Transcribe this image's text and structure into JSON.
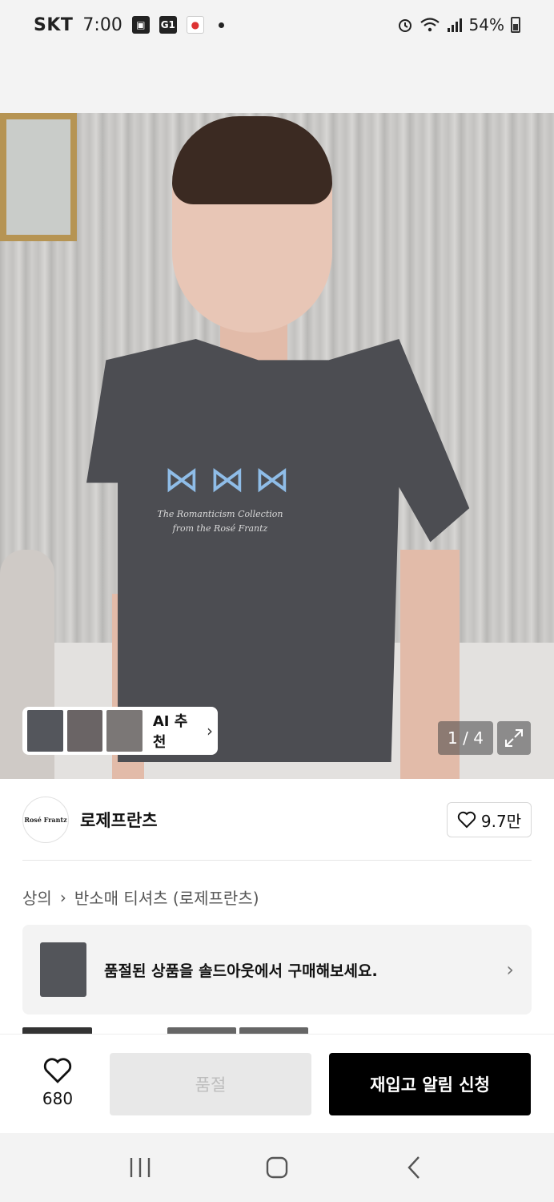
{
  "status_bar": {
    "carrier": "SKT",
    "time": "7:00",
    "notif_g1": "G1",
    "battery": "54%",
    "icons": [
      "gallery-icon",
      "g1-icon",
      "deal-icon",
      "alarm-icon",
      "wifi-icon",
      "signal-icon",
      "battery-icon"
    ]
  },
  "product_image": {
    "print_text": "The Romanticism Collection from the Rosé Frantz",
    "ai_recommend_label": "AI 추천",
    "counter": "1 / 4"
  },
  "brand": {
    "logo_text": "Rosé Frantz",
    "name": "로제프란츠",
    "likes": "9.7만"
  },
  "breadcrumb": {
    "category": "상의",
    "subcategory": "반소매 티셔츠 (로제프란츠)"
  },
  "soldout_banner": {
    "text": "품절된 상품을 솔드아웃에서 구매해보세요."
  },
  "bottom_bar": {
    "wish_count": "680",
    "soldout_label": "품절",
    "restock_label": "재입고 알림 신청"
  },
  "colors": {
    "accent": "#000000",
    "bow_blue": "#8fbde8",
    "shirt": "#4c4d52"
  }
}
